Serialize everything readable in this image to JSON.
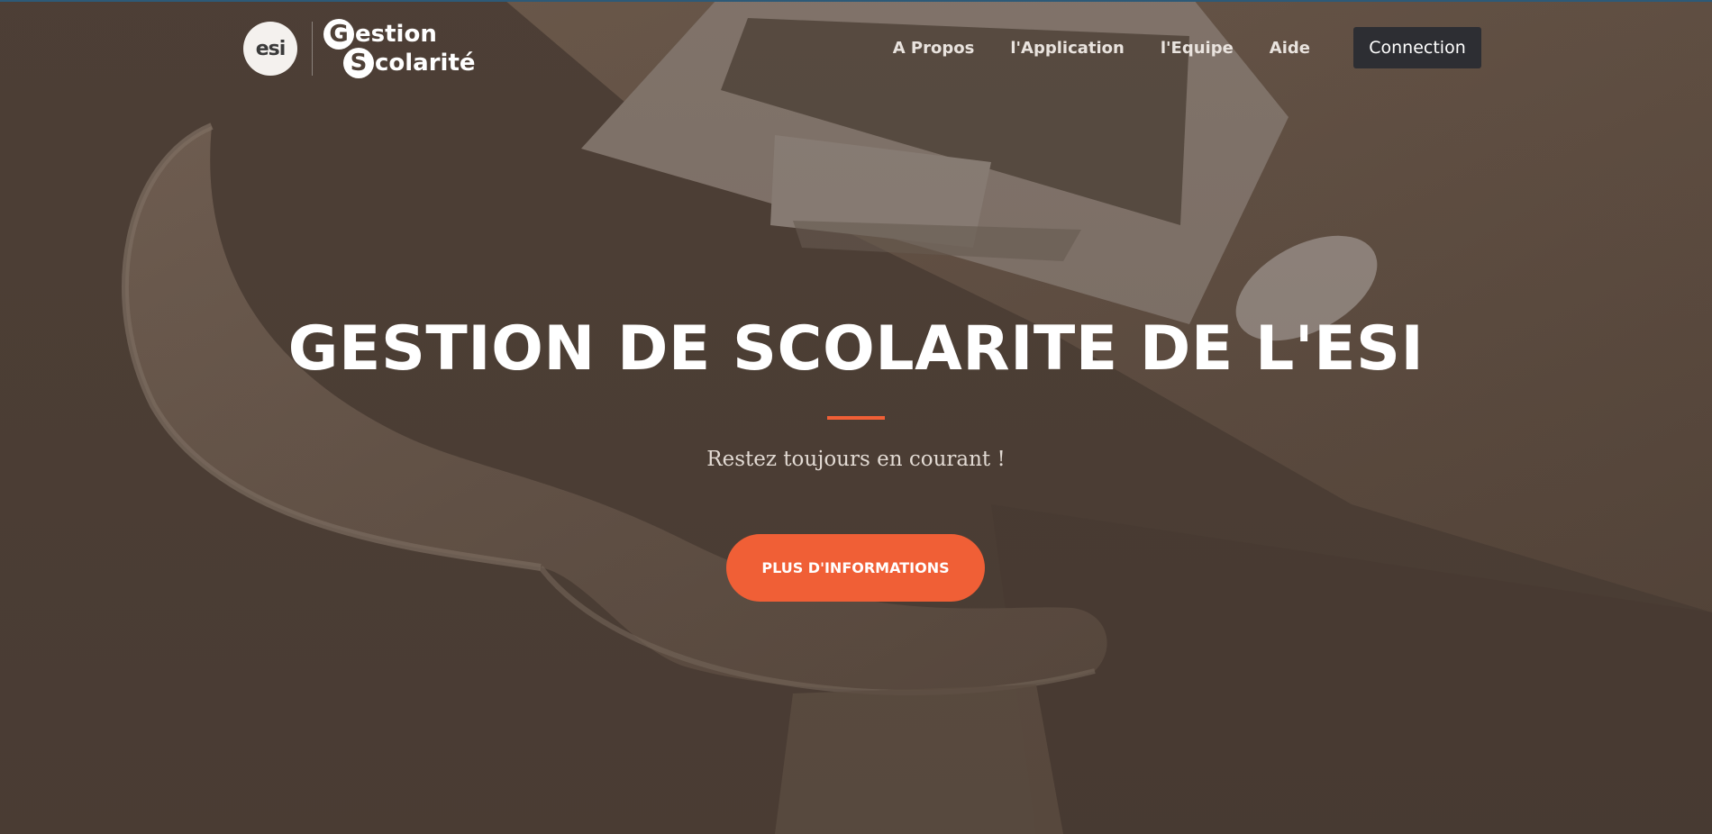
{
  "brand": {
    "logo_text": "esi",
    "line1_initial": "G",
    "line1_rest": "estion",
    "line2_initial": "S",
    "line2_rest": "colarité"
  },
  "nav": {
    "links": [
      {
        "label": "A Propos"
      },
      {
        "label": "l'Application"
      },
      {
        "label": "l'Equipe"
      },
      {
        "label": "Aide"
      }
    ],
    "connect_label": "Connection"
  },
  "hero": {
    "title": "GESTION DE SCOLARITE DE L'ESI",
    "subtitle": "Restez toujours en courant !",
    "cta_label": "PLUS D'INFORMATIONS"
  },
  "colors": {
    "accent": "#f05f36",
    "overlay": "#4e4037",
    "connect_button": "#2d2e33"
  },
  "background": {
    "image_content": [
      "laptop-icon",
      "mouse-icon",
      "chair-icon",
      "desk"
    ]
  }
}
